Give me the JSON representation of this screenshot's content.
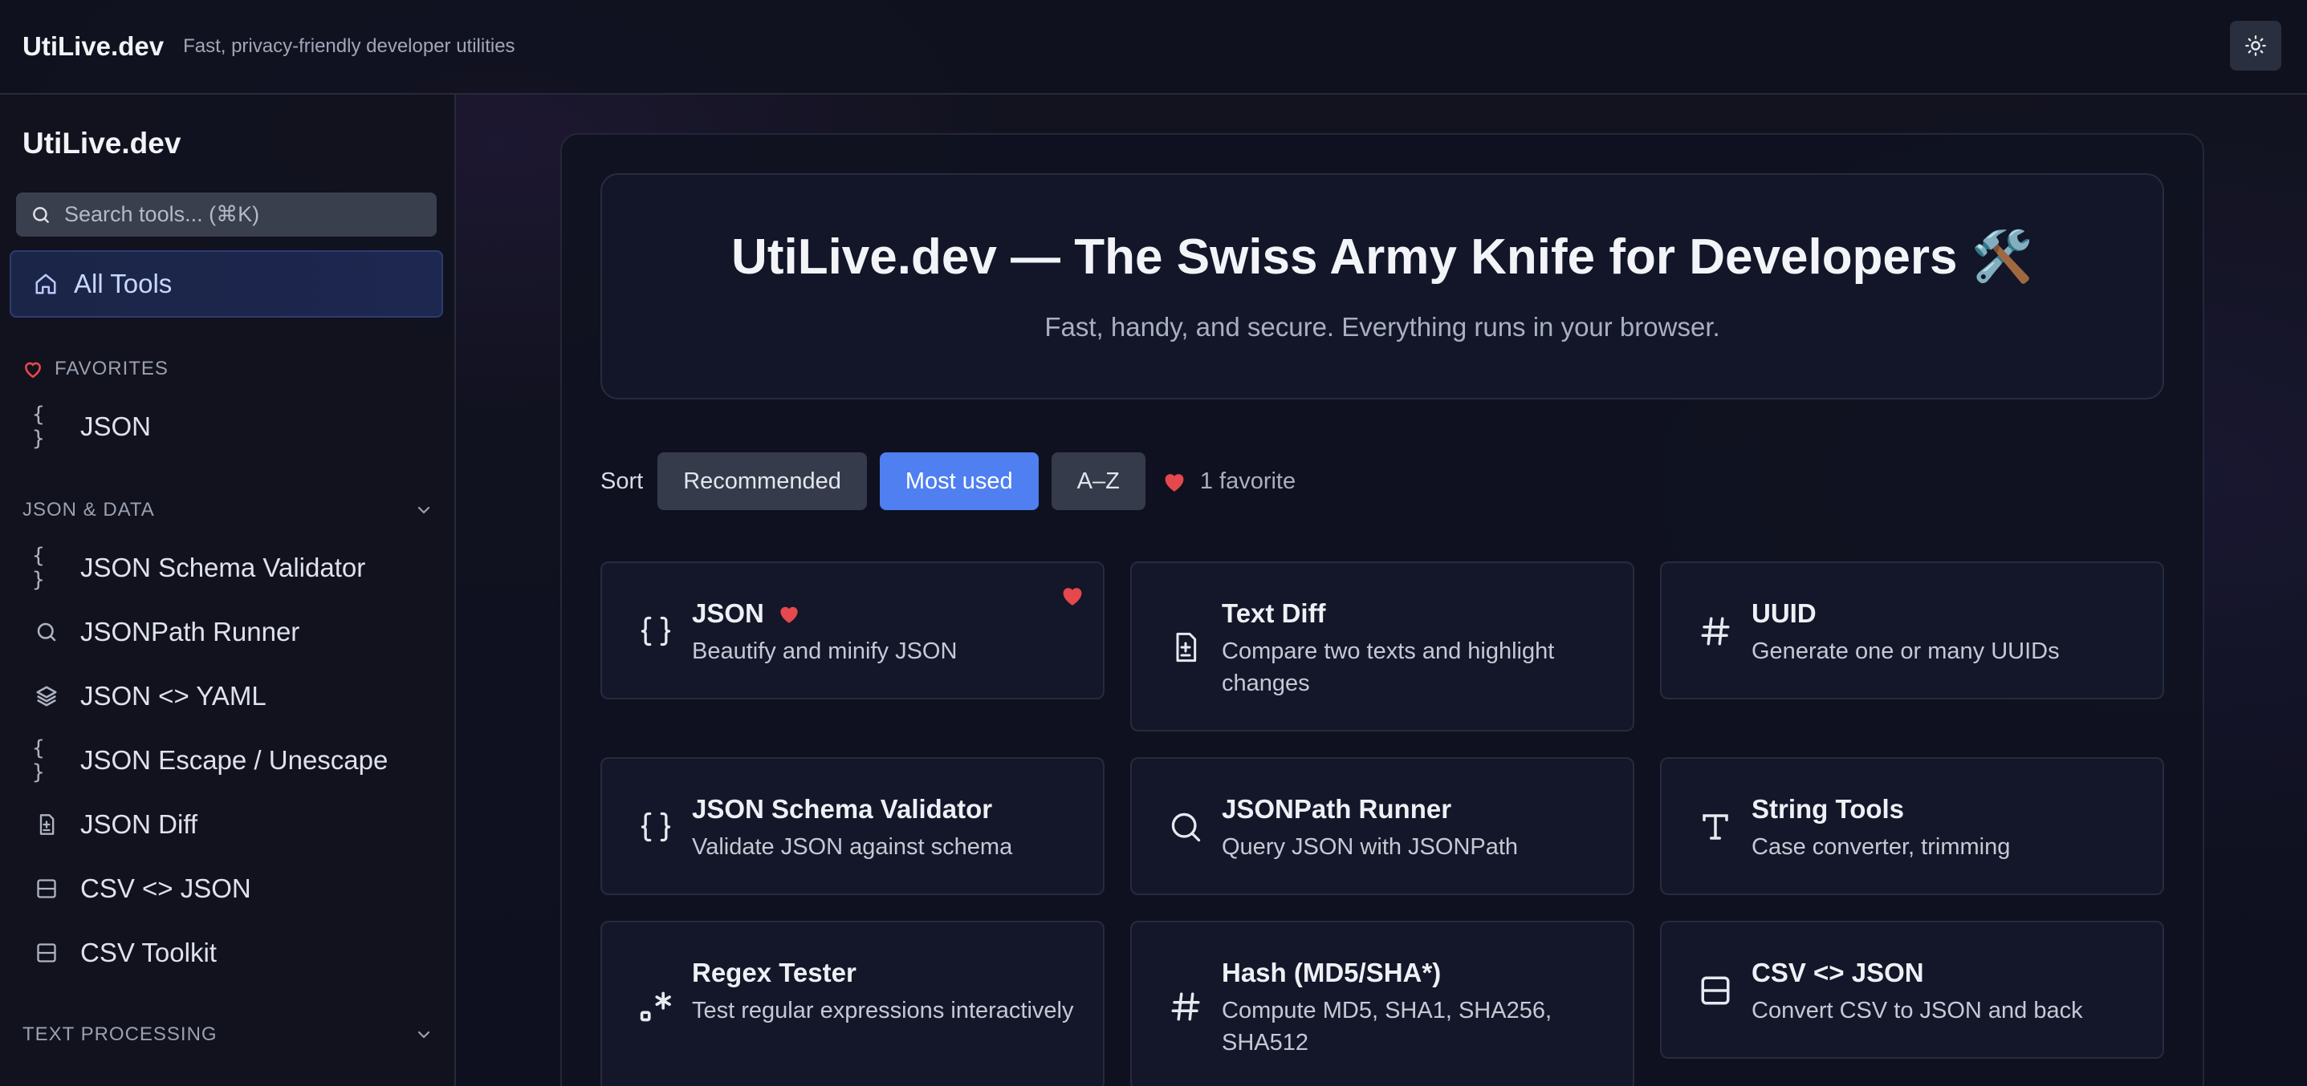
{
  "header": {
    "title": "UtiLive.dev",
    "tagline": "Fast, privacy-friendly developer utilities",
    "theme_toggle_icon": "sun-icon"
  },
  "sidebar": {
    "brand": "UtiLive.dev",
    "search_placeholder": "Search tools... (⌘K)",
    "all_tools_label": "All Tools",
    "favorites": {
      "heading": "FAVORITES",
      "items": [
        {
          "label": "JSON",
          "icon": "braces-icon"
        }
      ]
    },
    "sections": [
      {
        "heading": "JSON & DATA",
        "items": [
          {
            "label": "JSON Schema Validator",
            "icon": "braces-icon"
          },
          {
            "label": "JSONPath Runner",
            "icon": "search-icon"
          },
          {
            "label": "JSON <> YAML",
            "icon": "layers-icon"
          },
          {
            "label": "JSON Escape / Unescape",
            "icon": "braces-icon"
          },
          {
            "label": "JSON Diff",
            "icon": "file-diff-icon"
          },
          {
            "label": "CSV <> JSON",
            "icon": "table-icon"
          },
          {
            "label": "CSV Toolkit",
            "icon": "table-icon"
          }
        ]
      },
      {
        "heading": "TEXT PROCESSING",
        "items": []
      }
    ]
  },
  "hero": {
    "title": "UtiLive.dev — The Swiss Army Knife for Developers 🛠️",
    "subtitle": "Fast, handy, and secure. Everything runs in your browser."
  },
  "sort": {
    "label": "Sort",
    "options": [
      "Recommended",
      "Most used",
      "A–Z"
    ],
    "selected": "Most used",
    "favorite_count_text": "1 favorite"
  },
  "cards": [
    {
      "title": "JSON",
      "desc": "Beautify and minify JSON",
      "icon": "braces-icon",
      "favorite": true
    },
    {
      "title": "Text Diff",
      "desc": "Compare two texts and highlight changes",
      "icon": "file-diff-icon",
      "favorite": false
    },
    {
      "title": "UUID",
      "desc": "Generate one or many UUIDs",
      "icon": "hash-icon",
      "favorite": false
    },
    {
      "title": "JSON Schema Validator",
      "desc": "Validate JSON against schema",
      "icon": "braces-icon",
      "favorite": false
    },
    {
      "title": "JSONPath Runner",
      "desc": "Query JSON with JSONPath",
      "icon": "search-icon",
      "favorite": false
    },
    {
      "title": "String Tools",
      "desc": "Case converter, trimming",
      "icon": "type-icon",
      "favorite": false
    },
    {
      "title": "Regex Tester",
      "desc": "Test regular expressions interactively",
      "icon": "regex-icon",
      "favorite": false
    },
    {
      "title": "Hash (MD5/SHA*)",
      "desc": "Compute MD5, SHA1, SHA256, SHA512",
      "icon": "hash-icon",
      "favorite": false
    },
    {
      "title": "CSV <> JSON",
      "desc": "Convert CSV to JSON and back",
      "icon": "table-icon",
      "favorite": false
    }
  ],
  "colors": {
    "accent": "#4f7ff0",
    "heart": "#e5484d",
    "background": "#0d0f1a"
  }
}
